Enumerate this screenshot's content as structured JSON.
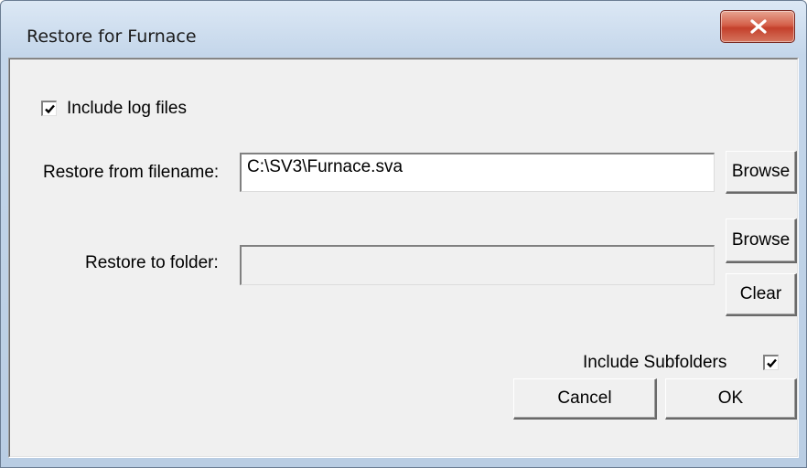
{
  "window": {
    "title": "Restore for Furnace",
    "close_label": "x"
  },
  "options": {
    "include_log_files_label": "Include log files",
    "include_log_files_checked": true,
    "include_subfolders_label": "Include Subfolders",
    "include_subfolders_checked": true
  },
  "restore_from": {
    "label": "Restore from filename:",
    "value": "C:\\SV3\\Furnace.sva",
    "browse_label": "Browse"
  },
  "restore_to": {
    "label": "Restore to folder:",
    "value": "",
    "browse_label": "Browse",
    "clear_label": "Clear"
  },
  "actions": {
    "cancel_label": "Cancel",
    "ok_label": "OK"
  },
  "colors": {
    "frame": "#c4d6ea",
    "client": "#f0f0f0",
    "close_button": "#c4402b"
  }
}
